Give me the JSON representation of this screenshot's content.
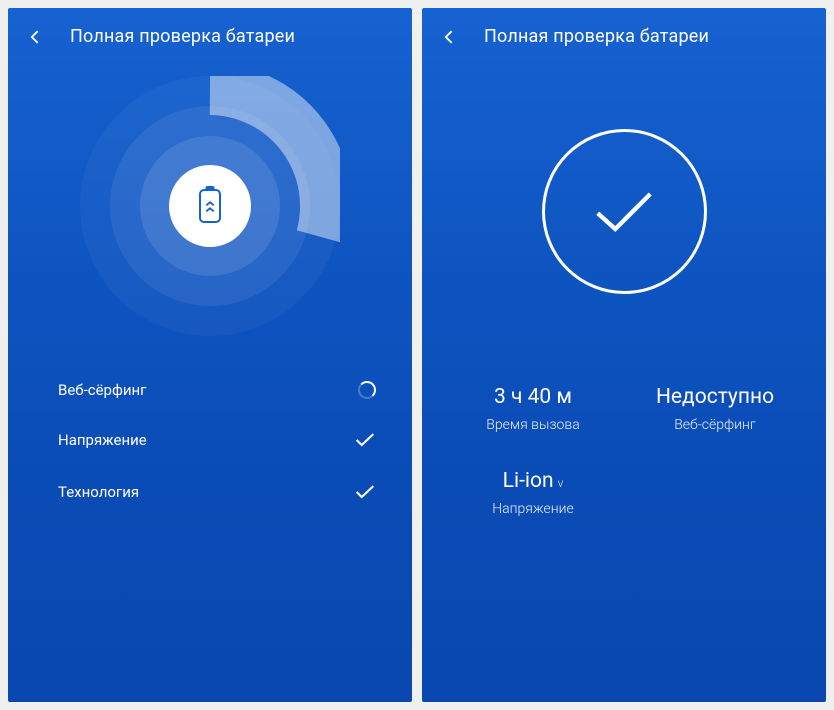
{
  "screen1": {
    "title": "Полная проверка батареи",
    "items": [
      {
        "label": "Веб-сёрфинг",
        "status": "loading"
      },
      {
        "label": "Напряжение",
        "status": "done"
      },
      {
        "label": "Технология",
        "status": "done"
      }
    ]
  },
  "screen2": {
    "title": "Полная проверка батареи",
    "stats": [
      {
        "value": "3 ч 40 м",
        "caption": "Время вызова"
      },
      {
        "value": "Недоступно",
        "caption": "Веб-сёрфинг"
      },
      {
        "value": "Li-ion",
        "suffix": "v",
        "caption": "Напряжение"
      }
    ]
  }
}
